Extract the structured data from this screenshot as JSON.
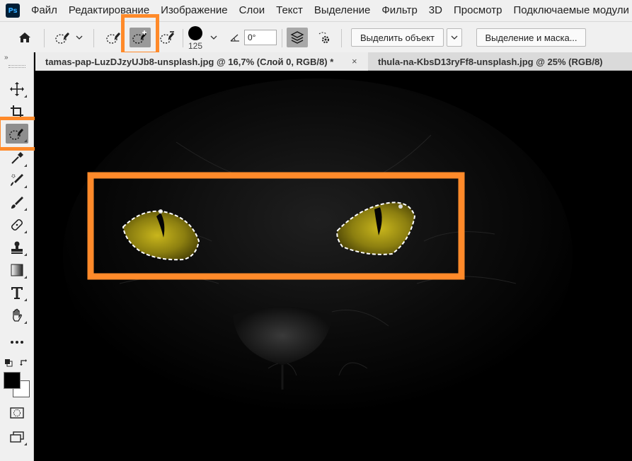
{
  "app": {
    "logo_text": "Ps"
  },
  "menu": [
    "Файл",
    "Редактирование",
    "Изображение",
    "Слои",
    "Текст",
    "Выделение",
    "Фильтр",
    "3D",
    "Просмотр",
    "Подключаемые модули"
  ],
  "options": {
    "brush_size": "125",
    "angle_value": "0°",
    "select_subject_label": "Выделить объект",
    "select_mask_label": "Выделение и маска..."
  },
  "tabs": [
    {
      "title": "tamas-pap-LuzDJzyUJb8-unsplash.jpg @ 16,7% (Слой 0, RGB/8) *",
      "close": "×"
    },
    {
      "title": "thula-na-KbsD13ryFf8-unsplash.jpg @ 25% (RGB/8)",
      "close": "×"
    }
  ],
  "toolbar": {
    "collapse": "»"
  },
  "colors": {
    "highlight": "#ff8a2a",
    "selection_ants": "#ffffff",
    "eye": "#a89a12"
  }
}
